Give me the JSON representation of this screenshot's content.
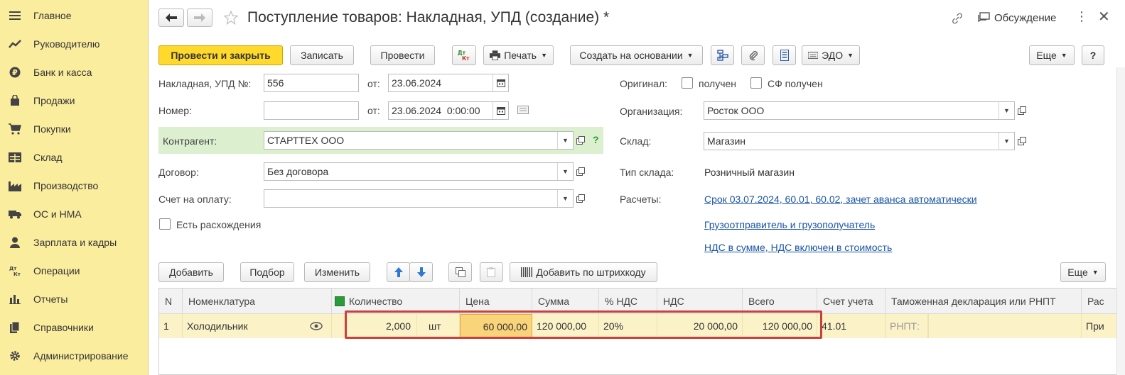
{
  "sidebar": {
    "items": [
      {
        "label": "Главное",
        "icon": "menu-icon"
      },
      {
        "label": "Руководителю",
        "icon": "trend-icon"
      },
      {
        "label": "Банк и касса",
        "icon": "ruble-icon"
      },
      {
        "label": "Продажи",
        "icon": "bag-icon"
      },
      {
        "label": "Покупки",
        "icon": "cart-icon"
      },
      {
        "label": "Склад",
        "icon": "warehouse-icon"
      },
      {
        "label": "Производство",
        "icon": "factory-icon"
      },
      {
        "label": "ОС и НМА",
        "icon": "truck-icon"
      },
      {
        "label": "Зарплата и кадры",
        "icon": "person-icon"
      },
      {
        "label": "Операции",
        "icon": "dt-kt-icon"
      },
      {
        "label": "Отчеты",
        "icon": "bar-chart-icon"
      },
      {
        "label": "Справочники",
        "icon": "books-icon"
      },
      {
        "label": "Администрирование",
        "icon": "gear-icon"
      }
    ]
  },
  "header": {
    "title": "Поступление товаров: Накладная, УПД (создание) *",
    "discussion": "Обсуждение"
  },
  "toolbar": {
    "post_close": "Провести и закрыть",
    "save": "Записать",
    "post": "Провести",
    "dtkt": "Дт Кт",
    "print": "Печать",
    "create_based": "Создать на основании",
    "edo": "ЭДО",
    "more": "Еще",
    "help": "?"
  },
  "form": {
    "invoice_label": "Накладная, УПД №:",
    "invoice_value": "556",
    "from_label": "от:",
    "invoice_date": "23.06.2024",
    "number_label": "Номер:",
    "number_value": "",
    "number_date": "23.06.2024  0:00:00",
    "counterparty_label": "Контрагент:",
    "counterparty_value": "СТАРТТЕХ ООО",
    "contract_label": "Договор:",
    "contract_value": "Без договора",
    "payment_label": "Счет на оплату:",
    "payment_value": "",
    "discrepancy_label": "Есть расхождения",
    "original_label": "Оригинал:",
    "received_label": "получен",
    "sf_received_label": "СФ получен",
    "org_label": "Организация:",
    "org_value": "Росток ООО",
    "warehouse_label": "Склад:",
    "warehouse_value": "Магазин",
    "warehouse_type_label": "Тип склада:",
    "warehouse_type_value": "Розничный магазин",
    "settlements_label": "Расчеты:",
    "settlements_link": "Срок 03.07.2024, 60.01, 60.02, зачет аванса автоматически",
    "shipper_link": "Грузоотправитель и грузополучатель",
    "vat_link": "НДС в сумме, НДС включен в стоимость"
  },
  "table_toolbar": {
    "add": "Добавить",
    "pick": "Подбор",
    "edit": "Изменить",
    "barcode": "Добавить по штрихкоду",
    "more": "Еще"
  },
  "table": {
    "headers": [
      "N",
      "Номенклатура",
      "Количество",
      "Цена",
      "Сумма",
      "% НДС",
      "НДС",
      "Всего",
      "Счет учета",
      "Таможенная декларация или РНПТ",
      "Рас"
    ],
    "rows": [
      {
        "n": "1",
        "item": "Холодильник",
        "qty": "2,000",
        "unit": "шт",
        "price": "60 000,00",
        "sum": "120 000,00",
        "vat_rate": "20%",
        "vat": "20 000,00",
        "total": "120 000,00",
        "account": "41.01",
        "rnpt": "РНПТ:",
        "extra": "При"
      }
    ]
  },
  "colors": {
    "sidebar_bg": "#fbed9e",
    "primary_button": "#ffd92c",
    "counterparty_highlight": "#dcf0d0",
    "row_selected": "#fbf2c8",
    "price_cell": "#f9d47a",
    "highlight_border": "#c9413c",
    "link": "#1a55a6"
  }
}
